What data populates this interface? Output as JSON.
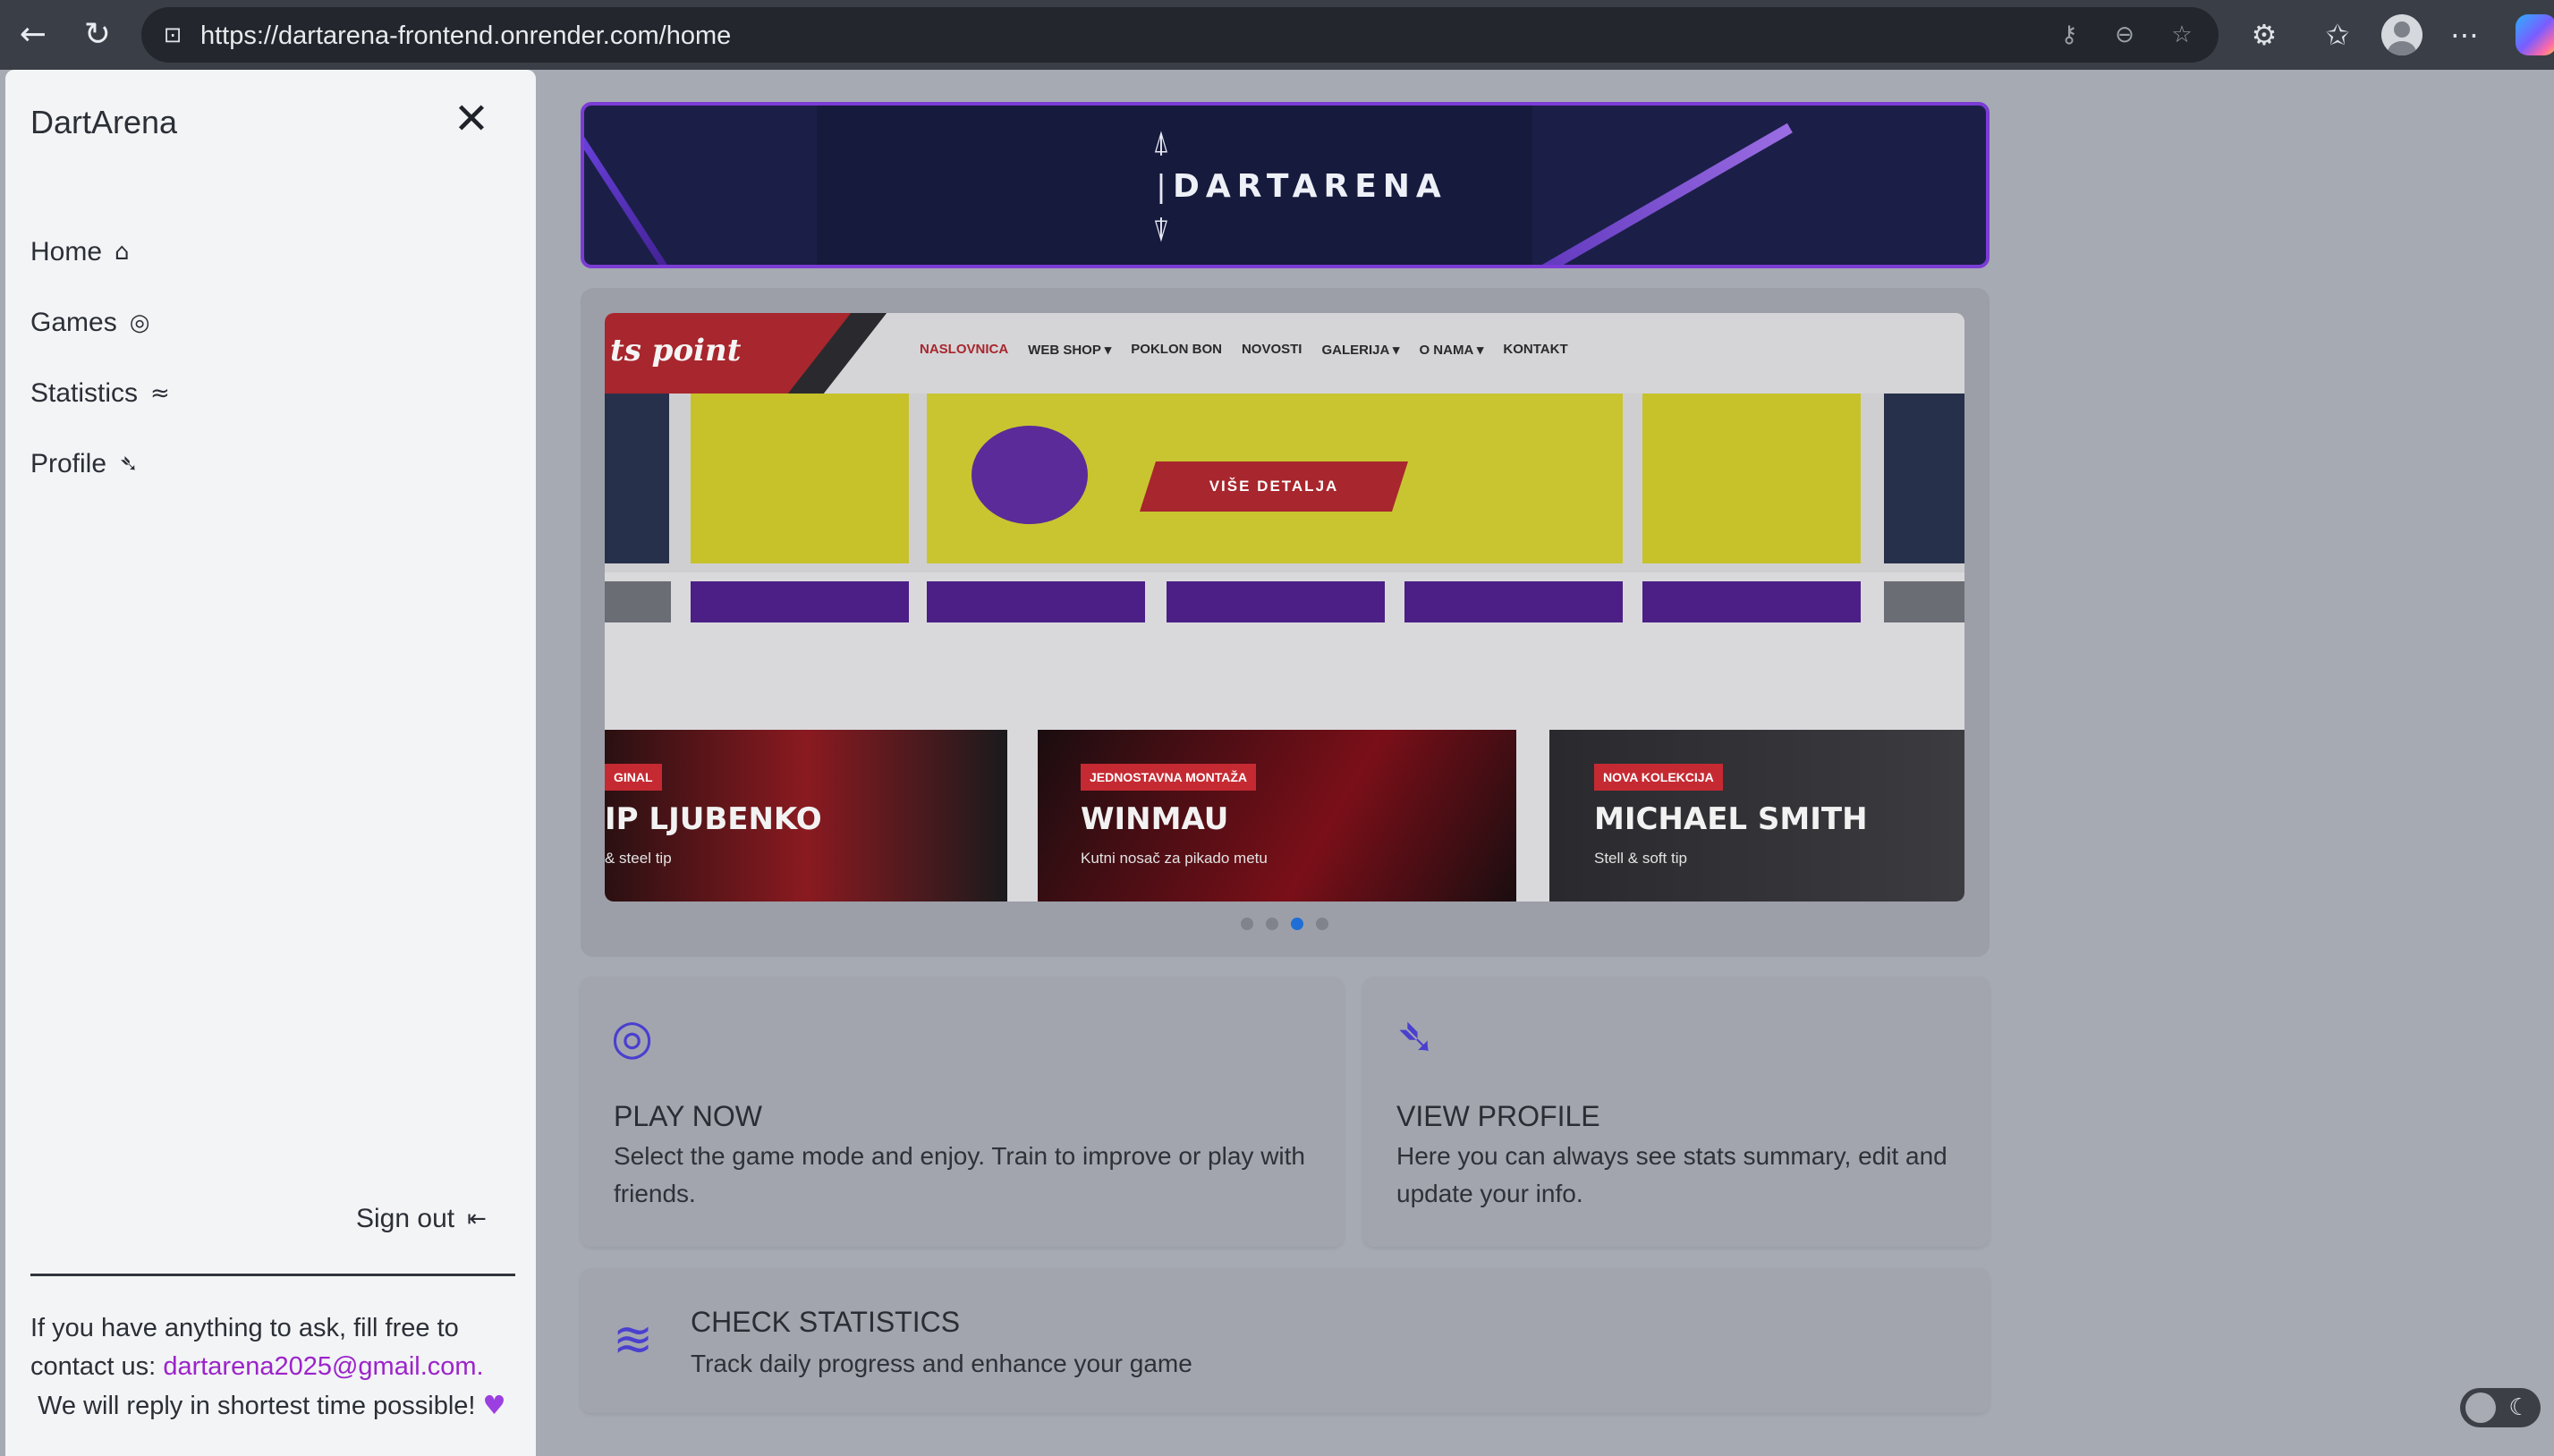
{
  "browser": {
    "url": "https://dartarena-frontend.onrender.com/home"
  },
  "sidebar": {
    "brand": "DartArena",
    "items": [
      {
        "label": "Home",
        "icon": "home-icon"
      },
      {
        "label": "Games",
        "icon": "target-icon"
      },
      {
        "label": "Statistics",
        "icon": "chart-lines-icon"
      },
      {
        "label": "Profile",
        "icon": "dart-icon"
      }
    ],
    "signout_label": "Sign out",
    "contact_prefix": "If you have anything to ask, fill free to contact us: ",
    "contact_email": "dartarena2025@gmail.com.",
    "contact_suffix": "We will reply in shortest time possible!"
  },
  "banner": {
    "title": "DARTARENA"
  },
  "carousel": {
    "site_logo": "ts point",
    "site_nav": [
      "NASLOVNICA",
      "WEB SHOP ▾",
      "POKLON BON",
      "NOVOSTI",
      "GALERIJA ▾",
      "O NAMA ▾",
      "KONTAKT"
    ],
    "hero_button": "VIŠE DETALJA",
    "promos": [
      {
        "tag": "GINAL",
        "title": "IP LJUBENKO",
        "sub": "& steel tip"
      },
      {
        "tag": "JEDNOSTAVNA MONTAŽA",
        "title": "WINMAU",
        "sub": "Kutni nosač za pikado metu"
      },
      {
        "tag": "NOVA KOLEKCIJA",
        "title": "MICHAEL SMITH",
        "sub": "Stell & soft tip"
      }
    ],
    "slide_count": 4,
    "active_slide": 3
  },
  "cards": {
    "play": {
      "title": "PLAY NOW",
      "desc": "Select the game mode and enjoy. Train to improve or play with friends."
    },
    "profile": {
      "title": "VIEW PROFILE",
      "desc": "Here you can always see stats summary, edit and update your info."
    },
    "stats": {
      "title": "CHECK STATISTICS",
      "desc": "Track daily progress and enhance your game"
    }
  },
  "colors": {
    "accent": "#4a3fcf",
    "email": "#9b24c9",
    "banner_border": "#7b3cd6"
  }
}
